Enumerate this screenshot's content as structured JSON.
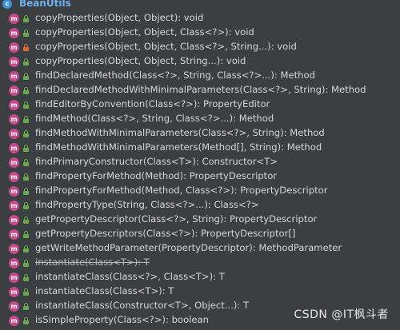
{
  "header": {
    "class_name": "BeanUtils",
    "class_icon": "c"
  },
  "methods": [
    {
      "signature": "copyProperties(Object, Object): void",
      "visibility": "public",
      "deprecated": false
    },
    {
      "signature": "copyProperties(Object, Object, Class<?>): void",
      "visibility": "public",
      "deprecated": false
    },
    {
      "signature": "copyProperties(Object, Object, Class<?>, String...): void",
      "visibility": "private",
      "deprecated": false
    },
    {
      "signature": "copyProperties(Object, Object, String...): void",
      "visibility": "public",
      "deprecated": false
    },
    {
      "signature": "findDeclaredMethod(Class<?>, String, Class<?>...): Method",
      "visibility": "public",
      "deprecated": false
    },
    {
      "signature": "findDeclaredMethodWithMinimalParameters(Class<?>, String): Method",
      "visibility": "public",
      "deprecated": false
    },
    {
      "signature": "findEditorByConvention(Class<?>): PropertyEditor",
      "visibility": "public",
      "deprecated": false
    },
    {
      "signature": "findMethod(Class<?>, String, Class<?>...): Method",
      "visibility": "public",
      "deprecated": false
    },
    {
      "signature": "findMethodWithMinimalParameters(Class<?>, String): Method",
      "visibility": "public",
      "deprecated": false
    },
    {
      "signature": "findMethodWithMinimalParameters(Method[], String): Method",
      "visibility": "public",
      "deprecated": false
    },
    {
      "signature": "findPrimaryConstructor(Class<T>): Constructor<T>",
      "visibility": "public",
      "deprecated": false
    },
    {
      "signature": "findPropertyForMethod(Method): PropertyDescriptor",
      "visibility": "public",
      "deprecated": false
    },
    {
      "signature": "findPropertyForMethod(Method, Class<?>): PropertyDescriptor",
      "visibility": "public",
      "deprecated": false
    },
    {
      "signature": "findPropertyType(String, Class<?>...): Class<?>",
      "visibility": "public",
      "deprecated": false
    },
    {
      "signature": "getPropertyDescriptor(Class<?>, String): PropertyDescriptor",
      "visibility": "public",
      "deprecated": false
    },
    {
      "signature": "getPropertyDescriptors(Class<?>): PropertyDescriptor[]",
      "visibility": "public",
      "deprecated": false
    },
    {
      "signature": "getWriteMethodParameter(PropertyDescriptor): MethodParameter",
      "visibility": "public",
      "deprecated": false
    },
    {
      "signature": "instantiate(Class<T>): T",
      "visibility": "public",
      "deprecated": true
    },
    {
      "signature": "instantiateClass(Class<?>, Class<T>): T",
      "visibility": "public",
      "deprecated": false
    },
    {
      "signature": "instantiateClass(Class<T>): T",
      "visibility": "public",
      "deprecated": false
    },
    {
      "signature": "instantiateClass(Constructor<T>, Object...): T",
      "visibility": "public",
      "deprecated": false
    },
    {
      "signature": "isSimpleProperty(Class<?>): boolean",
      "visibility": "public",
      "deprecated": false
    }
  ],
  "method_icon_letter": "m",
  "icons": {
    "class": "class-icon",
    "method": "method-icon",
    "public": "lock-open-icon",
    "private": "lock-icon"
  },
  "colors": {
    "background": "#3c3f41",
    "method_icon": "#c44a8c",
    "public_lock": "#6aa84f",
    "private_lock": "#d66a3a",
    "class_title": "#6fb0f0"
  },
  "watermark": "CSDN @IT枫斗者"
}
